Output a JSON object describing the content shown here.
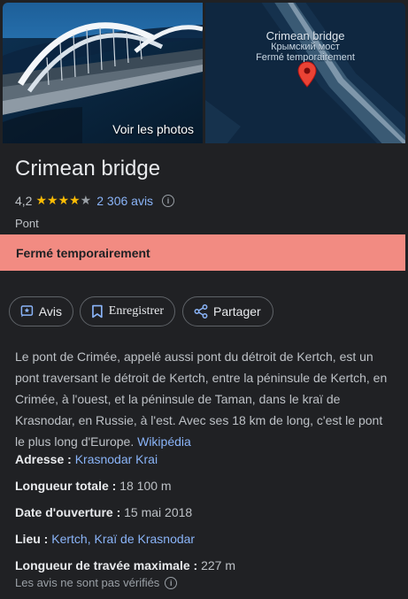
{
  "photos": {
    "see_photos_label": "Voir les photos"
  },
  "map": {
    "title": "Crimean bridge",
    "subtitle": "Крымский мост",
    "status": "Fermé temporairement"
  },
  "place": {
    "title": "Crimean bridge",
    "rating": "4,2",
    "stars_filled": 4,
    "stars_total": 5,
    "reviews_label": "2 306 avis",
    "category": "Pont"
  },
  "closed_banner": "Fermé temporairement",
  "actions": {
    "review_label": "Avis",
    "save_label": "Enregistrer",
    "share_label": "Partager"
  },
  "description": {
    "text": "Le pont de Crimée, appelé aussi pont du détroit de Kertch, est un pont traversant le détroit de Kertch, entre la péninsule de Kertch, en Crimée, à l'ouest, et la péninsule de Taman, dans le kraï de Krasnodar, en Russie, à l'est. Avec ses 18 km de long, c'est le pont le plus long d'Europe.",
    "source_link": "Wikipédia"
  },
  "attributes": {
    "address_label": "Adresse :",
    "address_value": "Krasnodar Krai",
    "length_label": "Longueur totale :",
    "length_value": "18 100 m",
    "opening_label": "Date d'ouverture :",
    "opening_value": "15 mai 2018",
    "place_label": "Lieu :",
    "place_value": "Kertch, Kraï de Krasnodar",
    "span_label": "Longueur de travée maximale :",
    "span_value": "227 m"
  },
  "footnote": "Les avis ne sont pas vérifiés",
  "colors": {
    "background": "#202124",
    "link": "#8ab4f8",
    "star": "#fbbc04",
    "closed_banner": "#f28b82"
  }
}
